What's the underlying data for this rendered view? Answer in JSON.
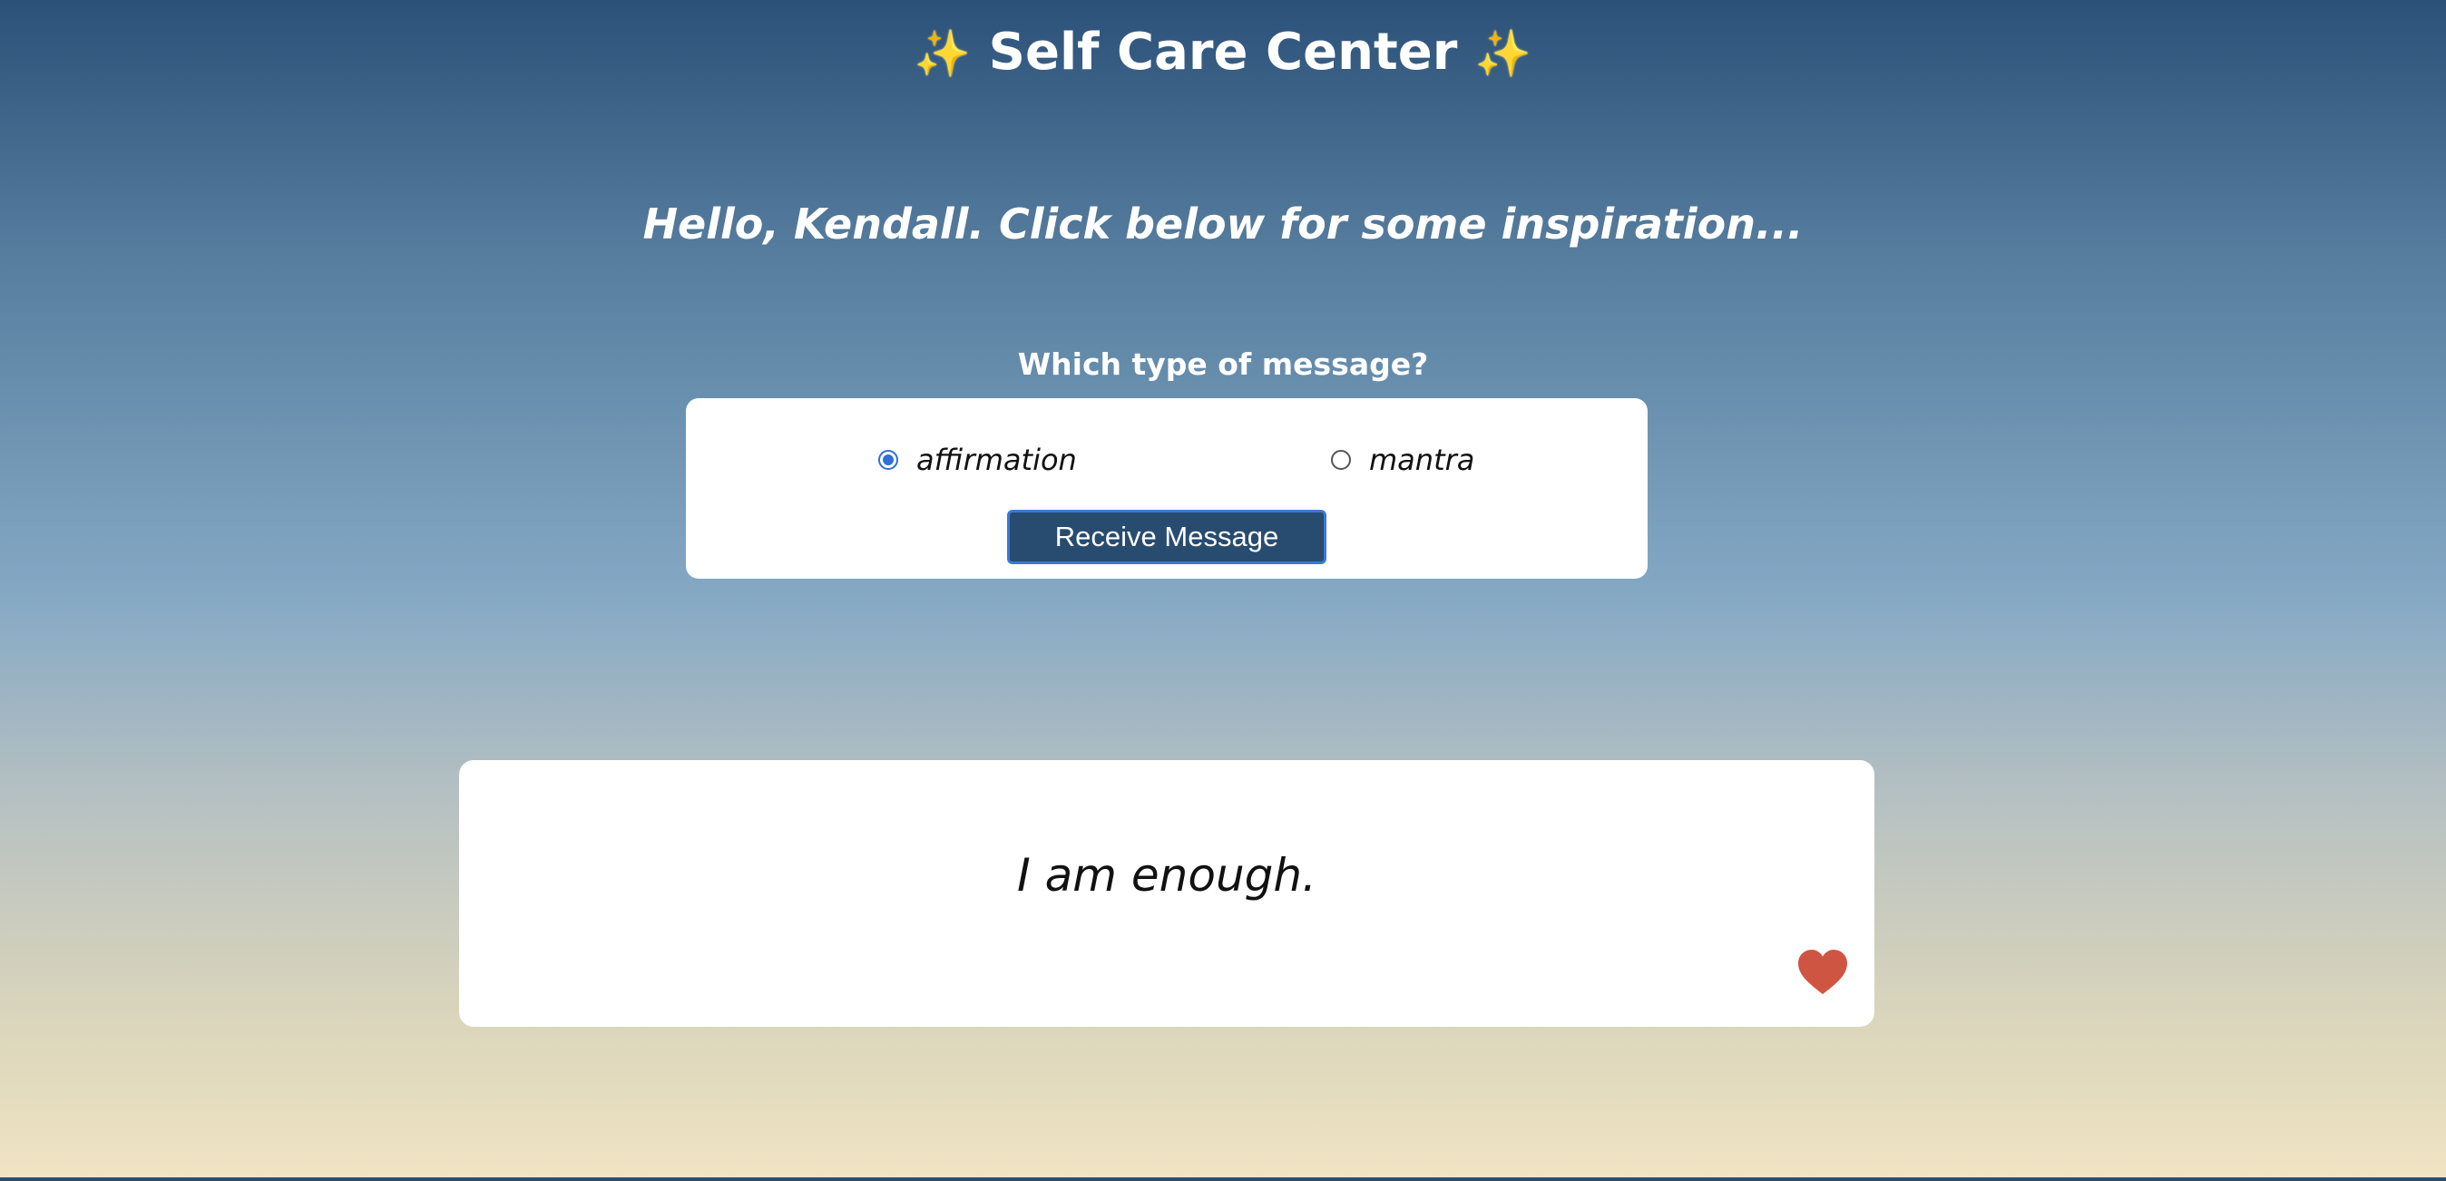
{
  "header": {
    "sparkle_left": "✨",
    "title": "Self Care Center",
    "sparkle_right": "✨"
  },
  "greeting": "Hello, Kendall. Click below for some inspiration...",
  "form": {
    "question": "Which type of message?",
    "options": [
      {
        "label": "affirmation",
        "checked": true
      },
      {
        "label": "mantra",
        "checked": false
      }
    ],
    "button_label": "Receive Message"
  },
  "message": {
    "text": "I am enough.",
    "favorite_icon": "heart-icon"
  },
  "colors": {
    "heart": "#cf5543",
    "button": "#284c6f",
    "radio_accent": "#2f6fd6"
  }
}
